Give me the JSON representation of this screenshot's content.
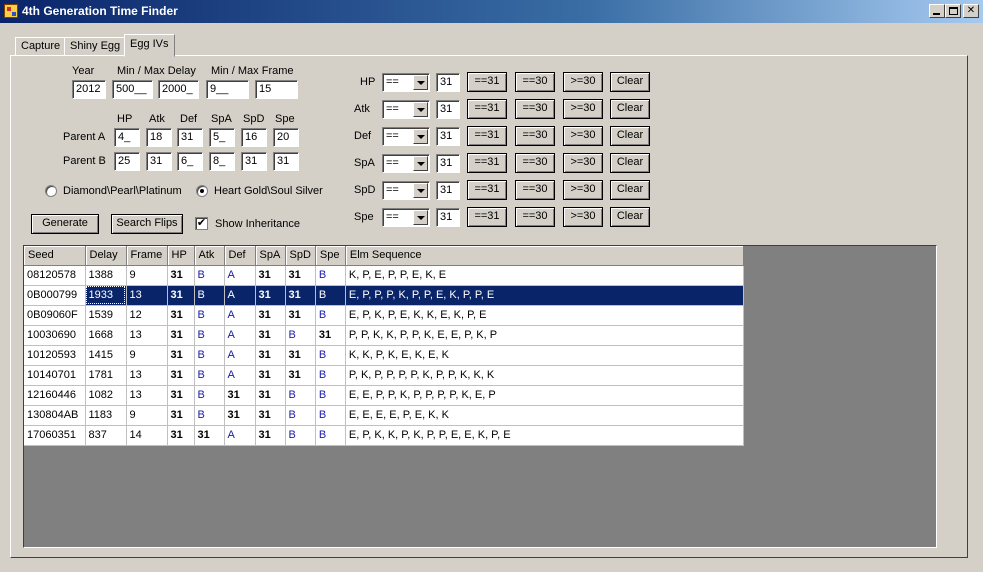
{
  "window": {
    "title": "4th Generation Time Finder"
  },
  "tabs": [
    "Capture",
    "Shiny Egg",
    "Egg IVs"
  ],
  "inputs": {
    "year_label": "Year",
    "delay_label": "Min / Max Delay",
    "frame_label": "Min / Max Frame",
    "year": "2012",
    "min_delay": "500__",
    "max_delay": "2000_",
    "min_frame": "9__",
    "max_frame": "15"
  },
  "parents": {
    "headers": [
      "HP",
      "Atk",
      "Def",
      "SpA",
      "SpD",
      "Spe"
    ],
    "a_label": "Parent A",
    "b_label": "Parent B",
    "a": [
      "4_",
      "18",
      "31",
      "5_",
      "16",
      "20"
    ],
    "b": [
      "25",
      "31",
      "6_",
      "8_",
      "31",
      "31"
    ]
  },
  "version": {
    "dpp": "Diamond\\Pearl\\Platinum",
    "hgss": "Heart Gold\\Soul Silver",
    "selected": "hgss"
  },
  "actions": {
    "generate": "Generate",
    "search_flips": "Search Flips",
    "show_inheritance": "Show Inheritance",
    "show_inheritance_checked": "✔"
  },
  "filters": [
    {
      "stat": "HP",
      "op": "==",
      "value": "31"
    },
    {
      "stat": "Atk",
      "op": "==",
      "value": "31"
    },
    {
      "stat": "Def",
      "op": "==",
      "value": "31"
    },
    {
      "stat": "SpA",
      "op": "==",
      "value": "31"
    },
    {
      "stat": "SpD",
      "op": "==",
      "value": "31"
    },
    {
      "stat": "Spe",
      "op": "==",
      "value": "31"
    }
  ],
  "filter_buttons": {
    "eq31": "==31",
    "eq30": "==30",
    "ge30": ">=30",
    "clear": "Clear"
  },
  "results": {
    "columns": [
      "Seed",
      "Delay",
      "Frame",
      "HP",
      "Atk",
      "Def",
      "SpA",
      "SpD",
      "Spe",
      "Elm Sequence"
    ],
    "selected_row": 1,
    "rows": [
      [
        "08120578",
        "1388",
        "9",
        "31",
        "B",
        "A",
        "31",
        "31",
        "B",
        "K, P, E, P, P, E, K, E"
      ],
      [
        "0B000799",
        "1933",
        "13",
        "31",
        "B",
        "A",
        "31",
        "31",
        "B",
        "E, P, P, P, K, P, P, E, K, P, P, E"
      ],
      [
        "0B09060F",
        "1539",
        "12",
        "31",
        "B",
        "A",
        "31",
        "31",
        "B",
        "E, P, K, P, E, K, K, E, K, P, E"
      ],
      [
        "10030690",
        "1668",
        "13",
        "31",
        "B",
        "A",
        "31",
        "B",
        "31",
        "P, P, K, K, P, P, K, E, E, P, K, P"
      ],
      [
        "10120593",
        "1415",
        "9",
        "31",
        "B",
        "A",
        "31",
        "31",
        "B",
        "K, K, P, K, E, K, E, K"
      ],
      [
        "10140701",
        "1781",
        "13",
        "31",
        "B",
        "A",
        "31",
        "31",
        "B",
        "P, K, P, P, P, P, K, P, P, K, K, K"
      ],
      [
        "12160446",
        "1082",
        "13",
        "31",
        "B",
        "31",
        "31",
        "B",
        "B",
        "E, E, P, P, K, P, P, P, P, K, E, P"
      ],
      [
        "130804AB",
        "1183",
        "9",
        "31",
        "B",
        "31",
        "31",
        "B",
        "B",
        "E, E, E, E, P, E, K, K"
      ],
      [
        "17060351",
        "837",
        "14",
        "31",
        "31",
        "A",
        "31",
        "B",
        "B",
        "E, P, K, K, P, K, P, P, E, E, K, P, E"
      ]
    ]
  }
}
